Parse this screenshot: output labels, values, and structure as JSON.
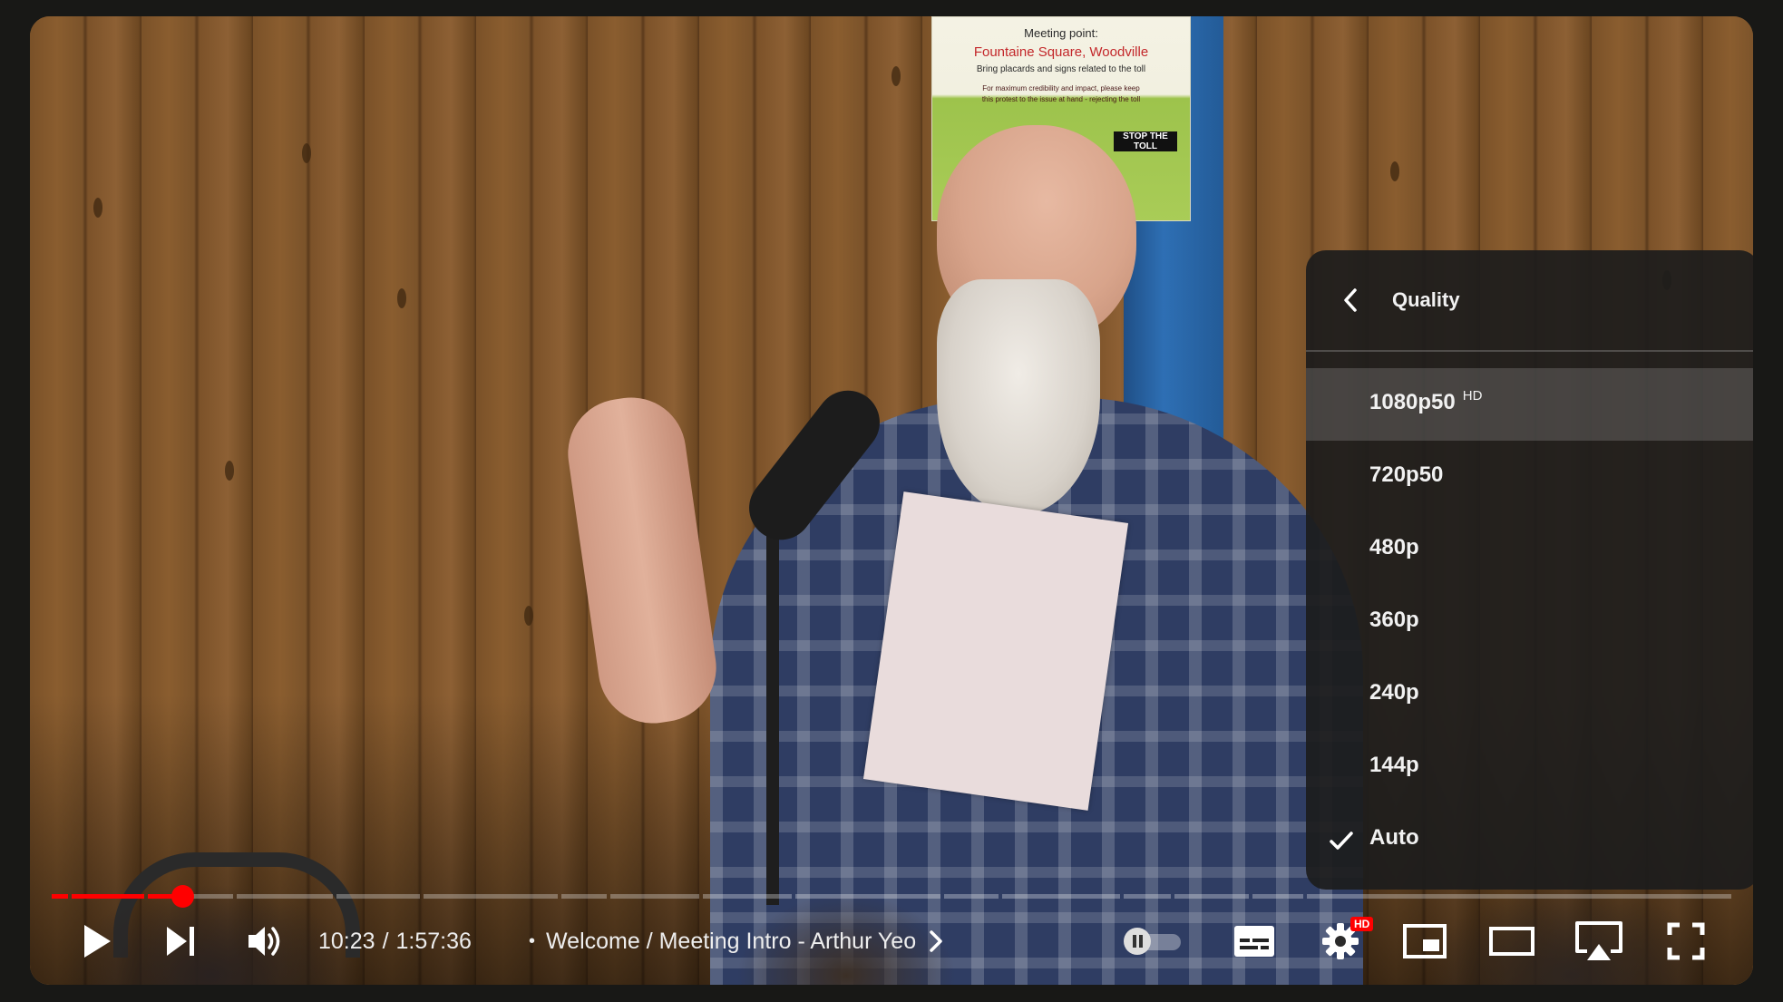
{
  "poster": {
    "line1": "Meeting point:",
    "line2": "Fountaine Square, Woodville",
    "line3": "Bring placards and signs related to the toll",
    "line4": "For maximum credibility and impact, please keep",
    "line5": "this protest to the issue at hand - rejecting the toll",
    "sign": "STOP THE TOLL"
  },
  "quality_menu": {
    "title": "Quality",
    "items": [
      {
        "label": "1080p50",
        "badge": "HD",
        "highlighted": true,
        "selected": false
      },
      {
        "label": "720p50",
        "badge": "",
        "highlighted": false,
        "selected": false
      },
      {
        "label": "480p",
        "badge": "",
        "highlighted": false,
        "selected": false
      },
      {
        "label": "360p",
        "badge": "",
        "highlighted": false,
        "selected": false
      },
      {
        "label": "240p",
        "badge": "",
        "highlighted": false,
        "selected": false
      },
      {
        "label": "144p",
        "badge": "",
        "highlighted": false,
        "selected": false
      },
      {
        "label": "Auto",
        "badge": "",
        "highlighted": false,
        "selected": true
      }
    ]
  },
  "playback": {
    "current_time": "10:23",
    "separator": "/",
    "duration": "1:57:36",
    "chapter_title": "Welcome / Meeting Intro - Arthur Yeo",
    "progress_fraction": 0.088
  },
  "controls": {
    "settings_badge": "HD",
    "autoplay_on": false
  },
  "colors": {
    "accent": "#ff0000",
    "menu_bg": "#1c1c1c",
    "text": "#f1f1f1"
  }
}
